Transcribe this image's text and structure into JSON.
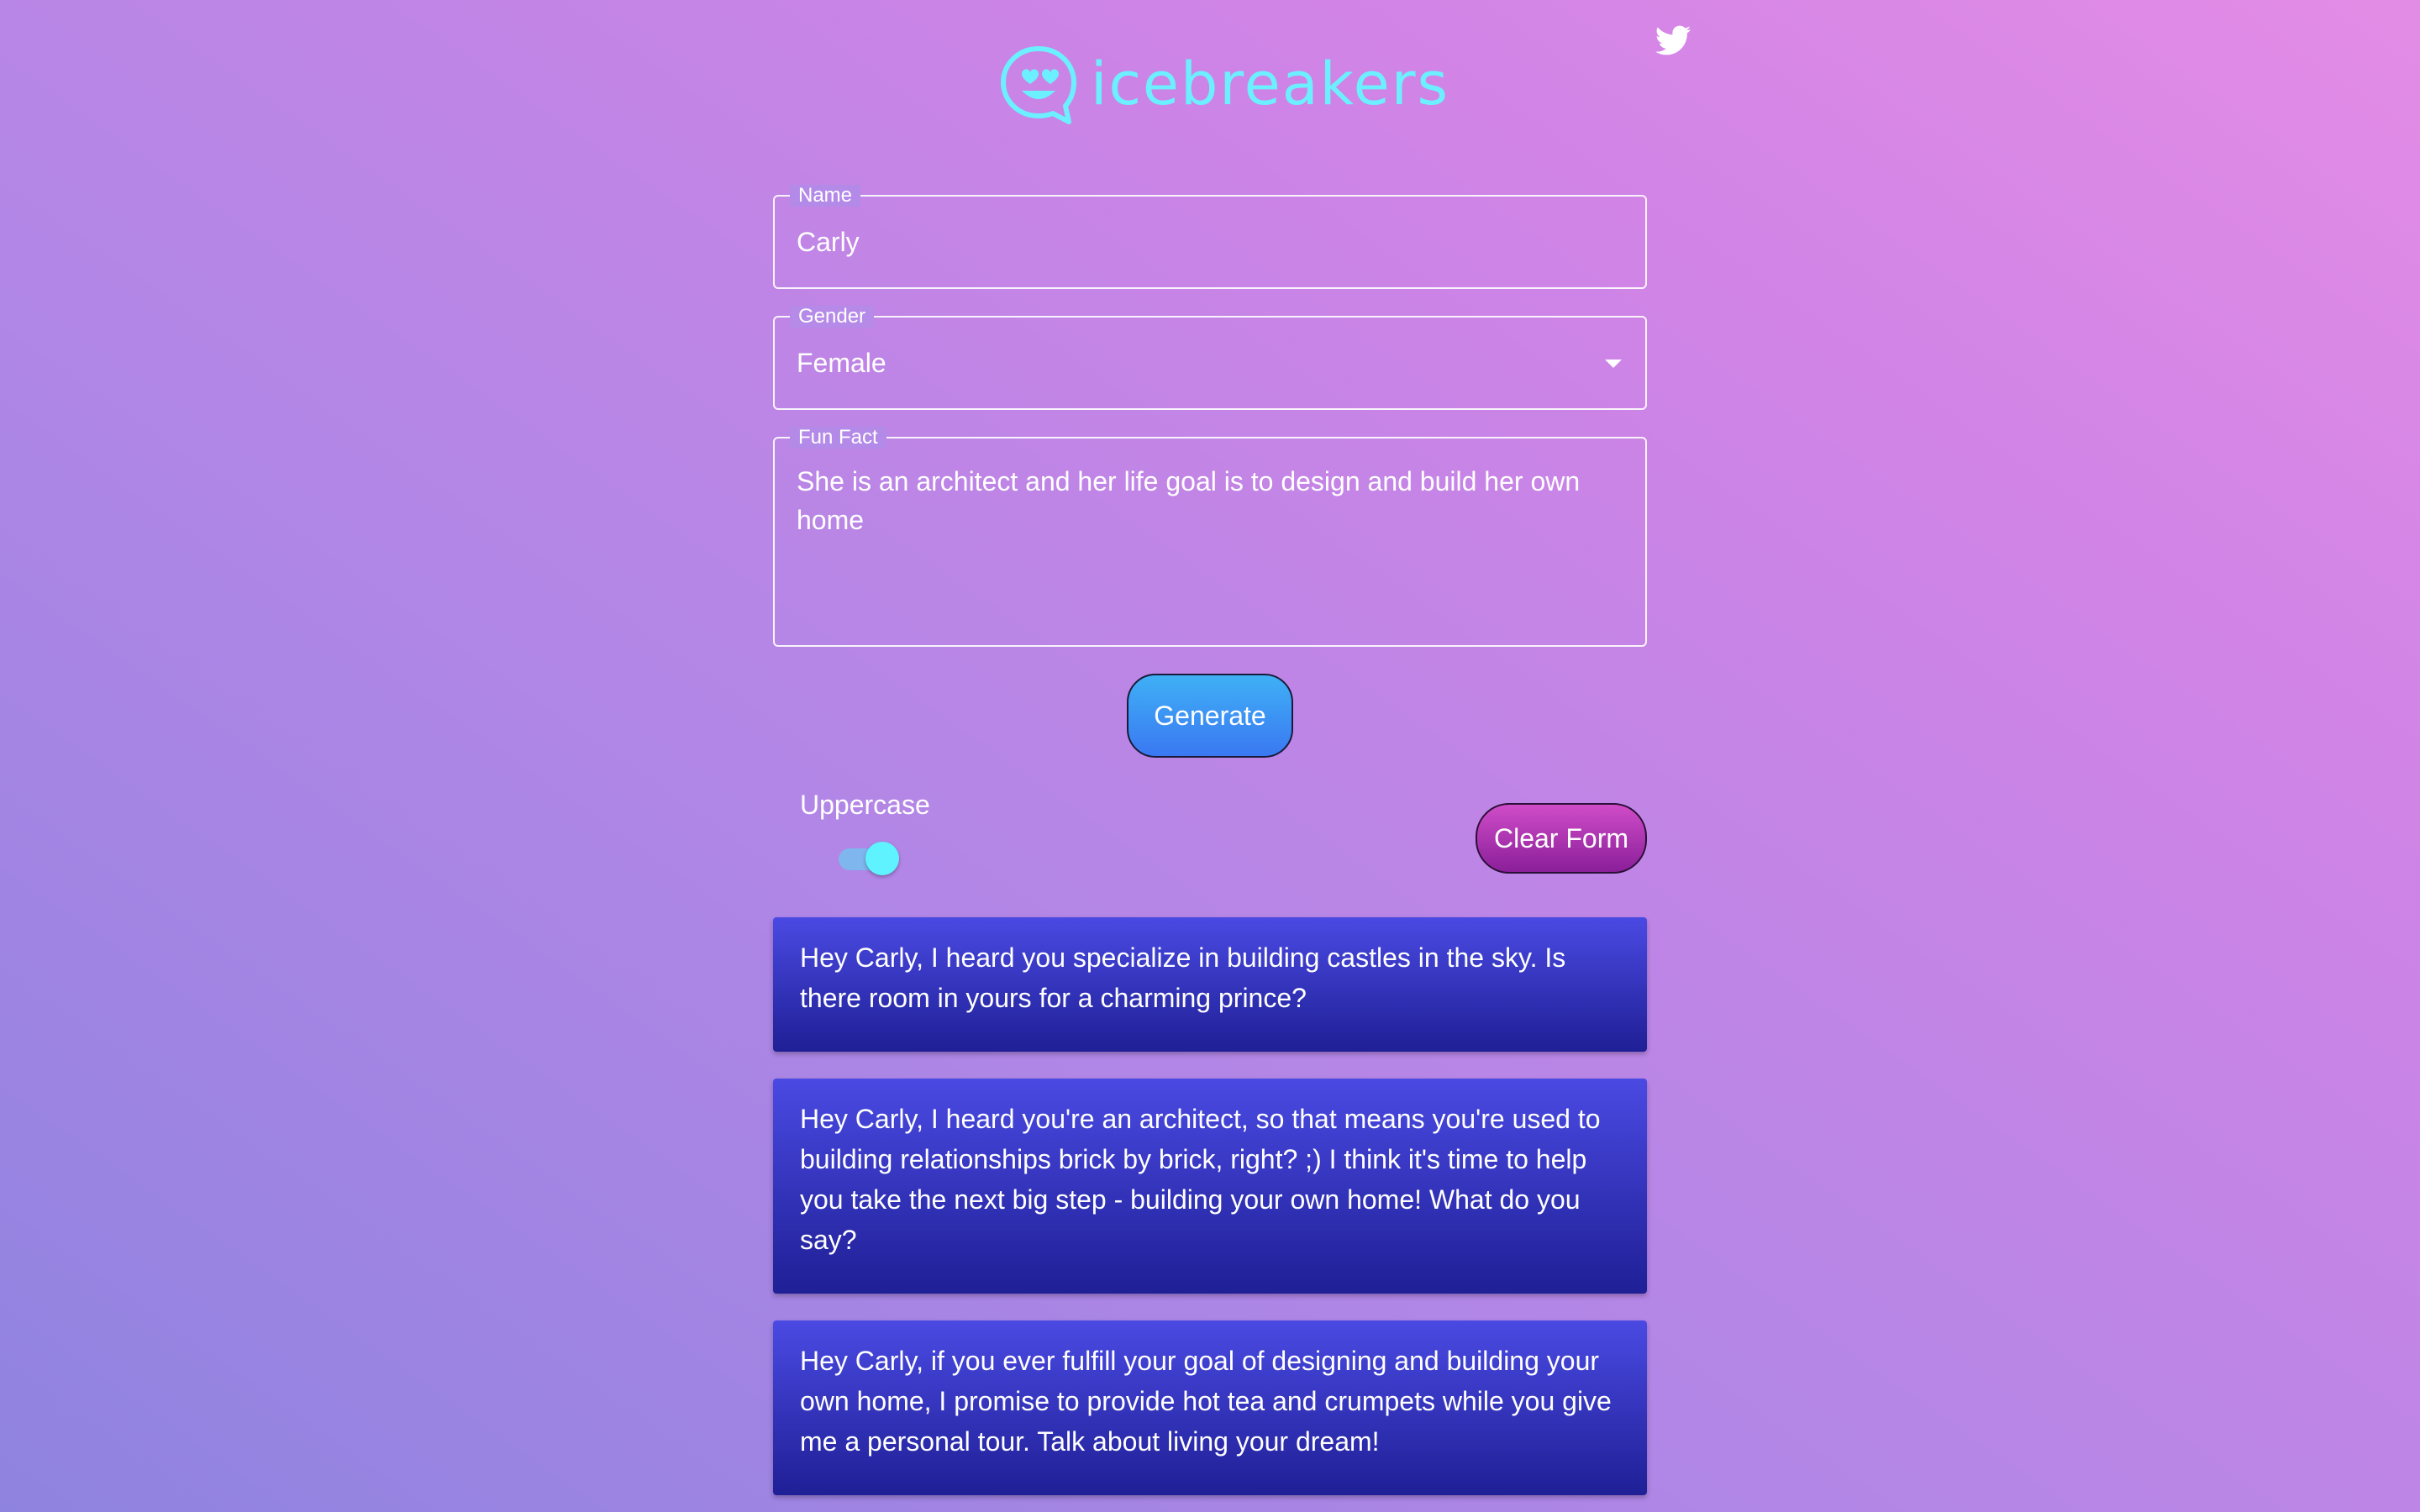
{
  "header": {
    "app_name": "icebreakers",
    "logo_icon": "smiley-heart-eyes-chat-bubble-icon",
    "twitter_icon": "twitter-bird-icon",
    "accent_color": "#6cf0ff"
  },
  "form": {
    "name": {
      "label": "Name",
      "value": "Carly"
    },
    "gender": {
      "label": "Gender",
      "value": "Female"
    },
    "fun_fact": {
      "label": "Fun Fact",
      "value": "She is an architect and her life goal is to design and build her own home"
    },
    "generate_label": "Generate",
    "uppercase_label": "Uppercase",
    "uppercase_on": true,
    "clear_label": "Clear Form"
  },
  "results": [
    {
      "text": "Hey Carly, I heard you specialize in building castles in the sky. Is there room in yours for a charming prince?"
    },
    {
      "text": "Hey Carly, I heard you're an architect, so that means you're used to building relationships brick by brick, right? ;) I think it's time to help you take the next big step - building your own home! What do you say?"
    },
    {
      "text": "Hey Carly, if you ever fulfill your goal of designing and building your own home, I promise to provide hot tea and crumpets while you give me a personal tour. Talk about living your dream!"
    }
  ]
}
